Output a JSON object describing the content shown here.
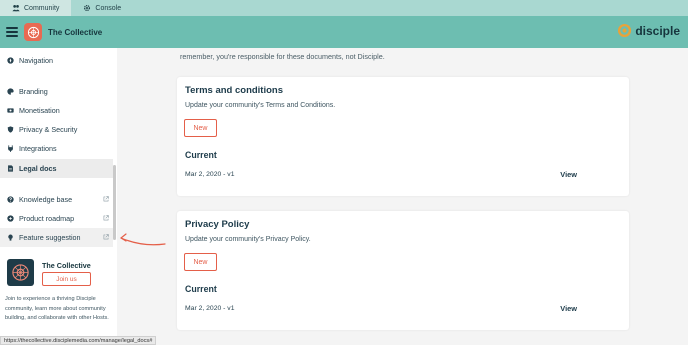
{
  "tabs": [
    {
      "label": "Community",
      "icon": "people-icon"
    },
    {
      "label": "Console",
      "icon": "gear-icon"
    }
  ],
  "header": {
    "title": "The Collective",
    "brand": "disciple"
  },
  "sidebar": {
    "items": [
      {
        "label": "Navigation",
        "icon": "compass-icon"
      },
      {
        "label": "Branding",
        "icon": "palette-icon"
      },
      {
        "label": "Monetisation",
        "icon": "money-icon"
      },
      {
        "label": "Privacy & Security",
        "icon": "shield-icon"
      },
      {
        "label": "Integrations",
        "icon": "plug-icon"
      },
      {
        "label": "Legal docs",
        "icon": "document-icon"
      }
    ],
    "links": [
      {
        "label": "Knowledge base",
        "icon": "question-icon"
      },
      {
        "label": "Product roadmap",
        "icon": "roadmap-icon"
      },
      {
        "label": "Feature suggestion",
        "icon": "lightbulb-icon"
      }
    ],
    "promo": {
      "title": "The Collective",
      "join_label": "Join us",
      "description": "Join to experience a thriving Disciple community, learn more about community building, and collaborate with other Hosts."
    }
  },
  "main": {
    "intro": "remember, you're responsible for these documents, not Disciple.",
    "cards": [
      {
        "title": "Terms and conditions",
        "description": "Update your community's Terms and Conditions.",
        "new_label": "New",
        "current_label": "Current",
        "version": "Mar 2, 2020 - v1",
        "view_label": "View"
      },
      {
        "title": "Privacy Policy",
        "description": "Update your community's Privacy Policy.",
        "new_label": "New",
        "current_label": "Current",
        "version": "Mar 2, 2020 - v1",
        "view_label": "View"
      }
    ]
  },
  "status_url": "https://thecollective.disciplemedia.com/manage/legal_docs#",
  "colors": {
    "header": "#6dbeb1",
    "tabbar": "#a9d8d1",
    "accent": "#e45f49",
    "text": "#1d3b4a"
  }
}
